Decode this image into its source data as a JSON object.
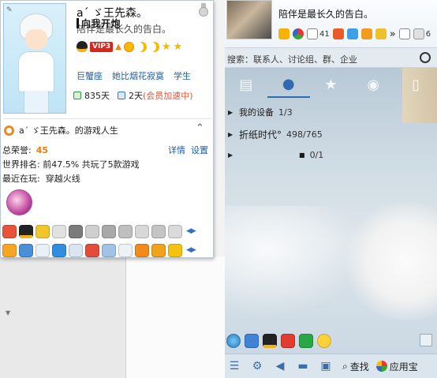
{
  "profile": {
    "nickname": "aˊ ゞ王先森。",
    "signature_overlay": "向我开炮",
    "signature": "陪伴是最长久的告白。",
    "vip_label": "VIP3",
    "tags": [
      "巨蟹座",
      "她比烟花寂寞",
      "学生"
    ],
    "active_days": "835天",
    "accel_days": "2天",
    "accel_note": "(会员加速中)"
  },
  "game": {
    "title": "aˊ ゞ王先森。的游戏人生",
    "honor_label": "总荣誉:",
    "honor_value": "45",
    "detail_link": "详情",
    "settings_link": "设置",
    "rank_line": "世界排名:  前47.5%  共玩了5款游戏",
    "playing_label": "最近在玩:",
    "playing_value": "穿越火线"
  },
  "qq": {
    "signature": "陪伴是最长久的告白。",
    "mail_count": "41",
    "skin_count": "6",
    "search_placeholder": "搜索：联系人、讨论组、群、企业",
    "groups": [
      {
        "name": "我的设备",
        "count": "1/3"
      },
      {
        "name": "折纸时代°",
        "count": "498/765"
      },
      {
        "name": "",
        "count": "0/1"
      }
    ],
    "find_label": "查找",
    "app_label": "应用宝"
  },
  "colors": {
    "accent_blue": "#1f5fb0",
    "vip_red": "#d9261c",
    "honor_orange": "#f57c00",
    "accel_red": "#e4543b"
  }
}
